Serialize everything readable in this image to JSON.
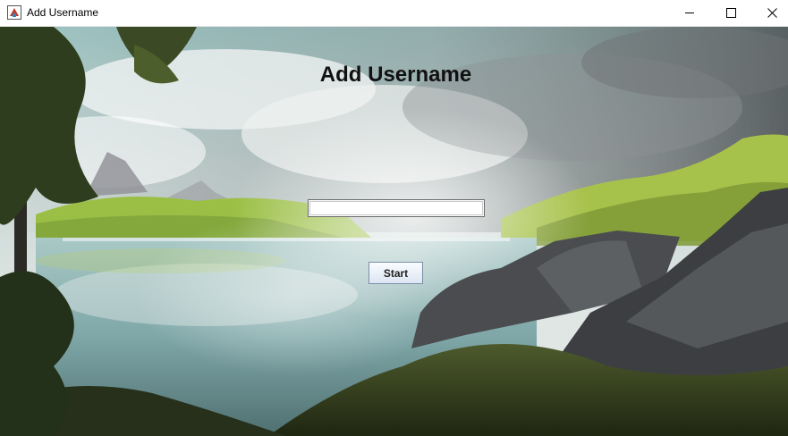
{
  "window": {
    "title": "Add Username",
    "controls": {
      "minimize_icon": "minimize-icon",
      "maximize_icon": "maximize-icon",
      "close_icon": "close-icon"
    }
  },
  "form": {
    "heading": "Add Username",
    "username_value": "",
    "start_label": "Start"
  },
  "colors": {
    "heading": "#111111",
    "titlebar_bg": "#ffffff"
  }
}
